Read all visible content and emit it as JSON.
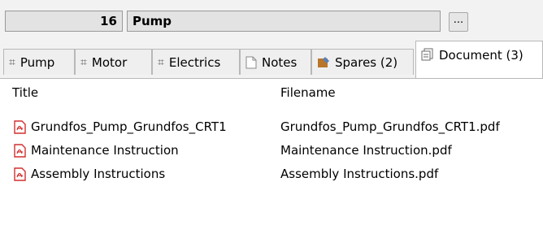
{
  "header": {
    "id": "16",
    "name": "Pump",
    "browse_label": "..."
  },
  "tabs": [
    {
      "label": "Pump",
      "icon": "hash-icon",
      "active": false
    },
    {
      "label": "Motor",
      "icon": "hash-icon",
      "active": false
    },
    {
      "label": "Electrics",
      "icon": "hash-icon",
      "active": false
    },
    {
      "label": "Notes",
      "icon": "note-icon",
      "active": false
    },
    {
      "label": "Spares (2)",
      "icon": "spares-icon",
      "active": false
    },
    {
      "label": "Document (3)",
      "icon": "document-icon",
      "active": true
    }
  ],
  "table": {
    "columns": [
      "Title",
      "Filename"
    ],
    "rows": [
      {
        "title": "Grundfos_Pump_Grundfos_CRT1",
        "filename": "Grundfos_Pump_Grundfos_CRT1.pdf"
      },
      {
        "title": "Maintenance Instruction",
        "filename": "Maintenance Instruction.pdf"
      },
      {
        "title": "Assembly Instructions",
        "filename": "Assembly Instructions.pdf"
      }
    ]
  },
  "colors": {
    "pdf_icon": "#d32f2f",
    "spares_icon": "#b8762a",
    "tab_border": "#b8b8b8"
  }
}
